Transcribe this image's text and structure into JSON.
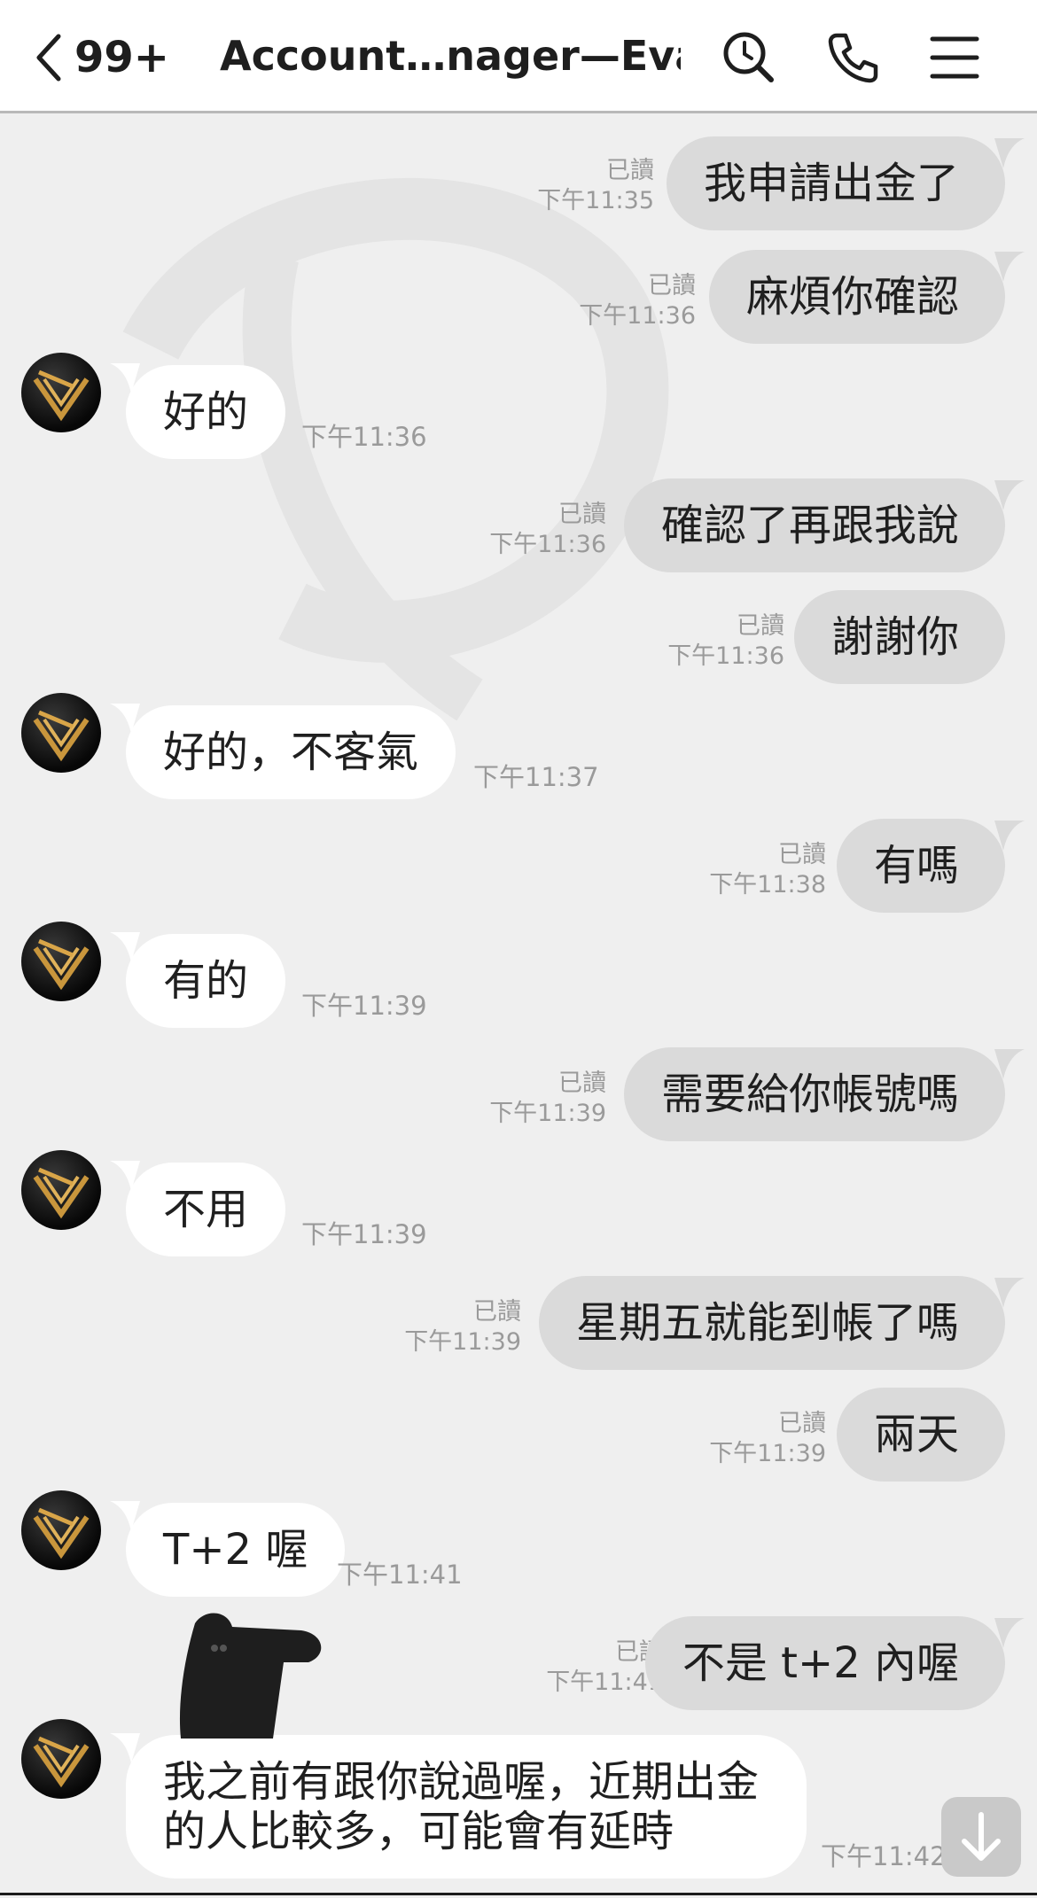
{
  "header": {
    "unread_count": "99+",
    "title": "Account…nager—Eva",
    "icons": [
      "back-chevron-icon",
      "search-icon",
      "phone-icon",
      "menu-icon"
    ]
  },
  "messages": [
    {
      "dir": "out",
      "text": "我申請出金了",
      "read": "已讀",
      "time": "下午11:35"
    },
    {
      "dir": "out",
      "text": "麻煩你確認",
      "read": "已讀",
      "time": "下午11:36"
    },
    {
      "dir": "in",
      "text": "好的",
      "time": "下午11:36"
    },
    {
      "dir": "out",
      "text": "確認了再跟我說",
      "read": "已讀",
      "time": "下午11:36"
    },
    {
      "dir": "out",
      "text": "謝謝你",
      "read": "已讀",
      "time": "下午11:36"
    },
    {
      "dir": "in",
      "text": "好的，不客氣",
      "time": "下午11:37"
    },
    {
      "dir": "out",
      "text": "有嗎",
      "read": "已讀",
      "time": "下午11:38"
    },
    {
      "dir": "in",
      "text": "有的",
      "time": "下午11:39"
    },
    {
      "dir": "out",
      "text": "需要給你帳號嗎",
      "read": "已讀",
      "time": "下午11:39"
    },
    {
      "dir": "in",
      "text": "不用",
      "time": "下午11:39"
    },
    {
      "dir": "out",
      "text": "星期五就能到帳了嗎",
      "read": "已讀",
      "time": "下午11:39"
    },
    {
      "dir": "out",
      "text": "兩天",
      "read": "已讀",
      "time": "下午11:39"
    },
    {
      "dir": "in",
      "text": "T+2 喔",
      "time": "下午11:41"
    },
    {
      "dir": "out",
      "text": "不是 t+2 內喔",
      "read": "已讀",
      "time": "下午11:41"
    },
    {
      "dir": "in",
      "text_lines": [
        "我之前有跟你說過喔，近期出金",
        "的人比較多，可能會有延時"
      ],
      "time": "下午11:42"
    }
  ],
  "colors": {
    "background": "#efefef",
    "out_bubble": "#dadada",
    "in_bubble": "#ffffff",
    "meta_text": "#9a9a9a",
    "avatar_gold": "#c9963c"
  },
  "scroll_button_icon": "arrow-down-icon"
}
